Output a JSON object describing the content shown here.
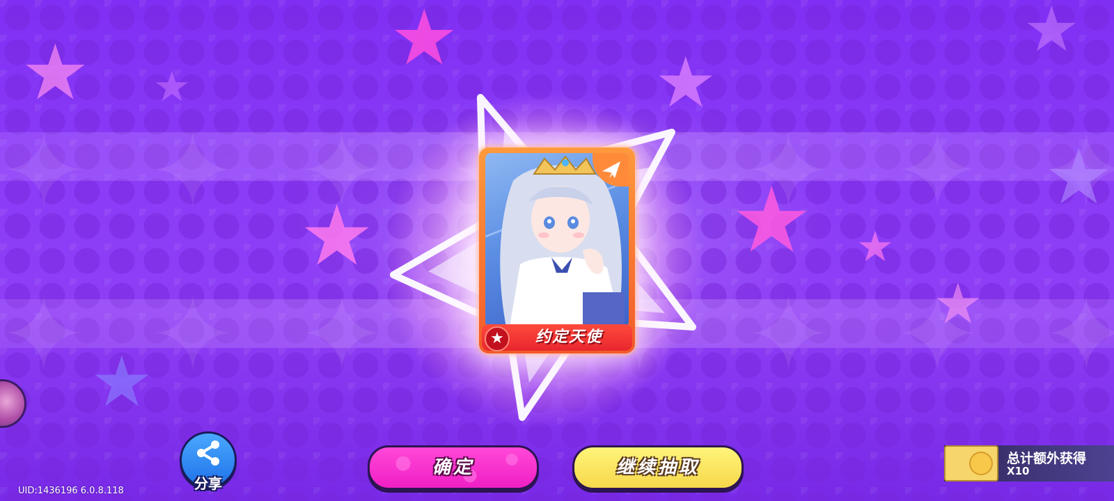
{
  "card": {
    "name": "约定天使",
    "badge_icon": "paper-plane-icon",
    "rarity_icon": "star-icon",
    "frame_color": "#ff7a35"
  },
  "share": {
    "label": "分享",
    "icon": "share-icon"
  },
  "buttons": {
    "confirm_label": "确定",
    "continue_label": "继续抽取"
  },
  "reward": {
    "title": "总计额外获得",
    "count": "X10",
    "icon": "ticket-icon"
  },
  "footer": {
    "uid_text": "UID:1436196 6.0.8.118"
  },
  "colors": {
    "background": "#8a3cf7",
    "confirm_button": "#f01fc4",
    "continue_button": "#f6d84b",
    "share_button": "#2f8af0"
  }
}
